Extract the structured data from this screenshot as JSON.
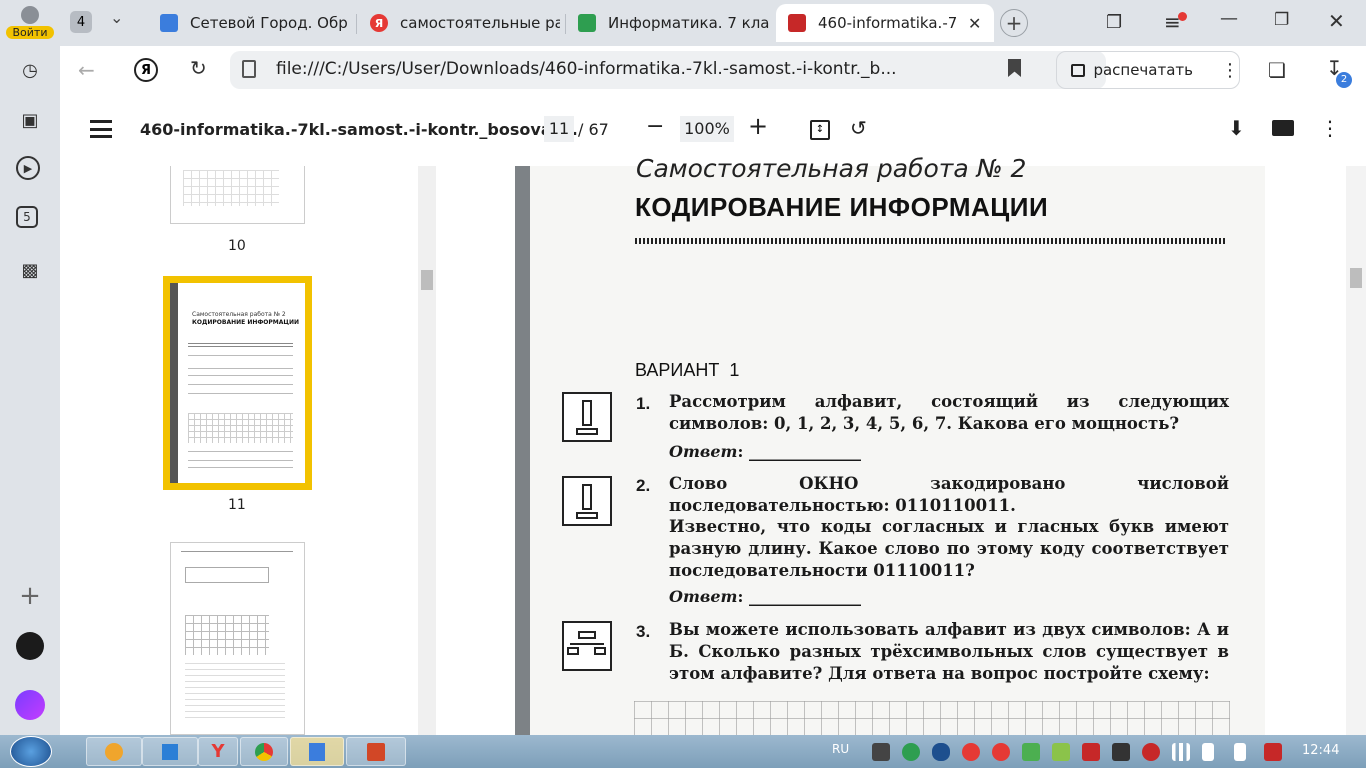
{
  "sidebar": {
    "login_label": "Войти",
    "badge5": "5"
  },
  "tabs": {
    "counter": "4",
    "items": [
      {
        "title": "Сетевой Город. Обр",
        "fav": "#3b7ddd"
      },
      {
        "title": "самостоятельные ра",
        "fav": "#e53935"
      },
      {
        "title": "Информатика. 7 кла",
        "fav": "#2e9e50"
      },
      {
        "title": "460-informatika.-7",
        "fav": "#c62828"
      }
    ],
    "new_tab": "+"
  },
  "address": {
    "url": "file:///C:/Users/User/Downloads/460-informatika.-7kl.-samost.-i-kontr._b...",
    "print_label": "распечатать",
    "downloads_badge": "2"
  },
  "pdf": {
    "title": "460-informatika.-7kl.-samost.-i-kontr._bosova_...",
    "current_page": "11",
    "total_pages": "/ 67",
    "zoom": "100%"
  },
  "thumbs": {
    "labels": [
      "10",
      "11"
    ],
    "mini_title": "Самостоятельная работа № 2",
    "mini_heading": "КОДИРОВАНИЕ ИНФОРМАЦИИ"
  },
  "doc": {
    "subtitle": "Самостоятельная работа № 2",
    "heading": "КОДИРОВАНИЕ ИНФОРМАЦИИ",
    "variant": "ВАРИАНТ  1",
    "questions": [
      {
        "num": "1.",
        "text": "Рассмотрим алфавит, состоящий из следующих символов: 0, 1, 2, 3, 4, 5, 6, 7. Какова его мощность?"
      },
      {
        "num": "2.",
        "text": "Слово ОКНО закодировано числовой последовательностью: 0110110011.",
        "text2": "Известно, что коды согласных и гласных букв имеют разную длину. Какое слово по этому коду соответствует последовательности 01110011?"
      },
      {
        "num": "3.",
        "text": "Вы можете использовать алфавит из двух символов: А и Б. Сколько разных трёхсимвольных слов существует в этом алфавите? Для ответа на вопрос постройте схему:"
      }
    ],
    "answer_label": "Ответ",
    "answer_tail": ": ______________"
  },
  "taskbar": {
    "lang": "RU",
    "time": "12:44"
  },
  "colors": {
    "highlight": "#f2c200",
    "accent": "#3b7ddd"
  }
}
